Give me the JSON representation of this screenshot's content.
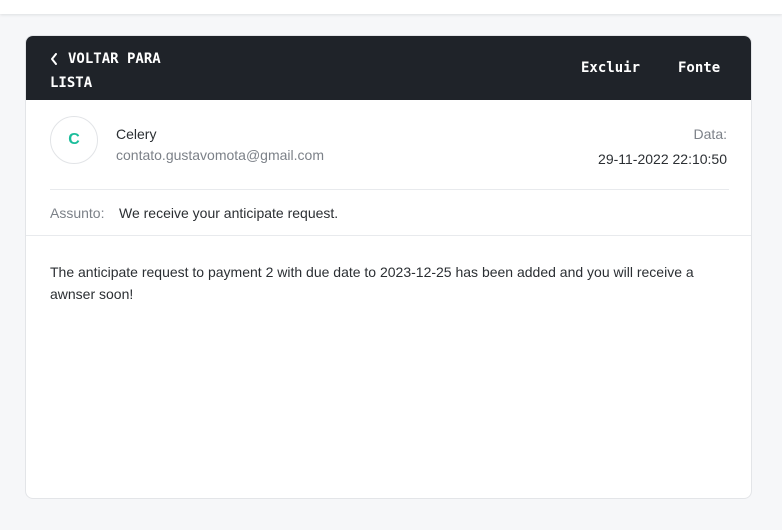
{
  "header": {
    "back_label": "VOLTAR PARA LISTA",
    "delete_label": "Excluir",
    "source_label": "Fonte"
  },
  "message": {
    "avatar_initial": "C",
    "sender_name": "Celery",
    "sender_email": "contato.gustavomota@gmail.com",
    "date_label": "Data:",
    "date_value": "29-11-2022 22:10:50",
    "subject_label": "Assunto:",
    "subject_value": "We receive your anticipate request.",
    "body": "The anticipate request to payment 2 with due date to 2023-12-25 has been added and you will receive a awnser soon!"
  },
  "colors": {
    "header_bg": "#1f2329",
    "avatar_accent": "#1bbd9b",
    "page_bg": "#f6f7f9"
  },
  "icons": {
    "back": "chevron-left-icon"
  }
}
